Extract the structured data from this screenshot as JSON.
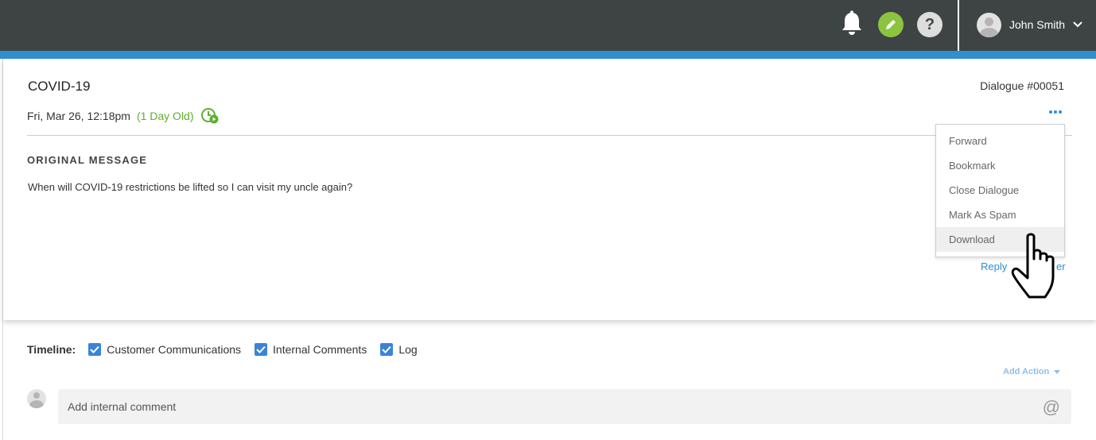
{
  "header": {
    "user_name": "John Smith",
    "help_glyph": "?",
    "icons": [
      "bell-icon",
      "pencil-icon",
      "help-icon",
      "avatar",
      "chevron-down-icon"
    ],
    "accent_color": "#2f8fd1",
    "bar_color": "#3e4444"
  },
  "dialogue": {
    "title": "COVID-19",
    "id": "Dialogue #00051",
    "date": "Fri, Mar 26, 12:18pm",
    "age": "(1 Day Old)",
    "section_title": "ORIGINAL MESSAGE",
    "message": "When will COVID-19 restrictions be lifted so I can visit my uncle again?",
    "reply_link": "Reply",
    "other_link": "er"
  },
  "menu": {
    "items": [
      "Forward",
      "Bookmark",
      "Close Dialogue",
      "Mark As Spam",
      "Download"
    ],
    "highlighted": "Download"
  },
  "timeline": {
    "label": "Timeline:",
    "filters": [
      {
        "label": "Customer Communications",
        "checked": true
      },
      {
        "label": "Internal Comments",
        "checked": true
      },
      {
        "label": "Log",
        "checked": true
      }
    ]
  },
  "actions": {
    "add_action": "Add Action"
  },
  "comment": {
    "placeholder": "Add internal comment",
    "mention_glyph": "@"
  }
}
